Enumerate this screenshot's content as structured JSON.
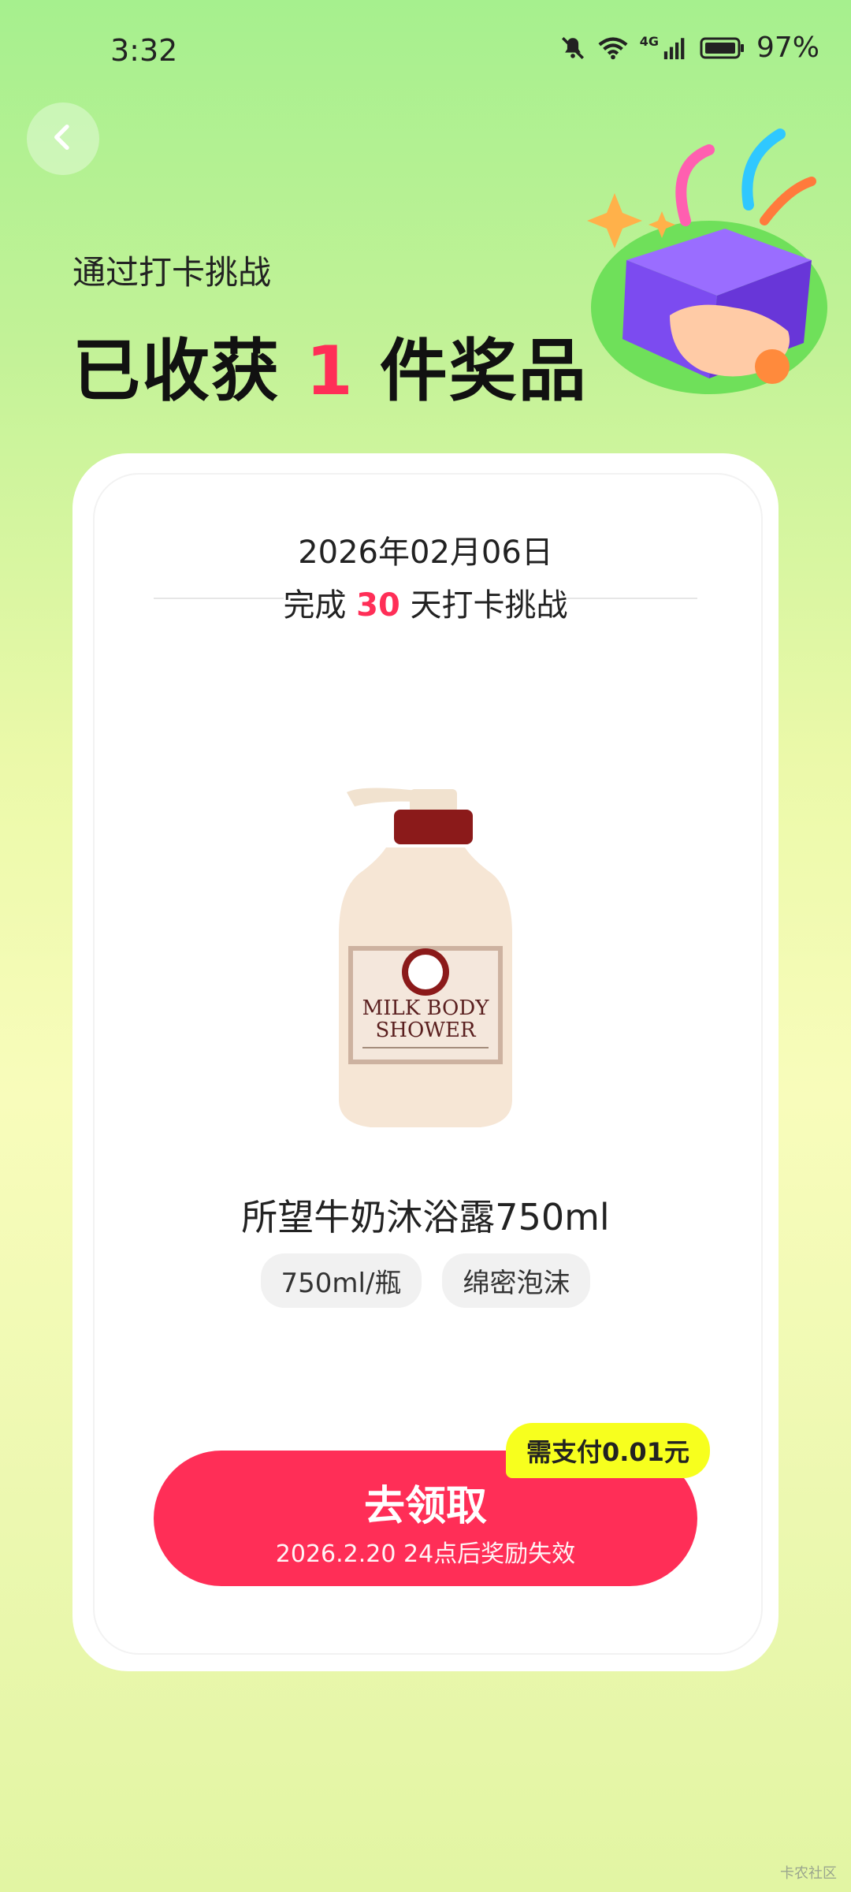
{
  "status_bar": {
    "time": "3:32",
    "network": "4G",
    "battery": "97%"
  },
  "header": {
    "subtitle": "通过打卡挑战",
    "headline_prefix": "已收获",
    "headline_count": "1",
    "headline_suffix": "件奖品"
  },
  "card": {
    "date": "2026年02月06日",
    "challenge_prefix": "完成",
    "challenge_days": "30",
    "challenge_suffix": "天打卡挑战",
    "product_name": "所望牛奶沐浴露750ml",
    "product_label_line1": "MILK BODY",
    "product_label_line2": "SHOWER",
    "tags": [
      "750ml/瓶",
      "绵密泡沫"
    ],
    "pay_badge": "需支付0.01元",
    "claim_button": "去领取",
    "claim_expiry": "2026.2.20 24点后奖励失效"
  },
  "watermark": "卡农社区",
  "colors": {
    "accent": "#ff2e57",
    "badge": "#f7ff1e",
    "bg_top": "#a6f08e",
    "bg_bottom": "#f8fcbb"
  }
}
